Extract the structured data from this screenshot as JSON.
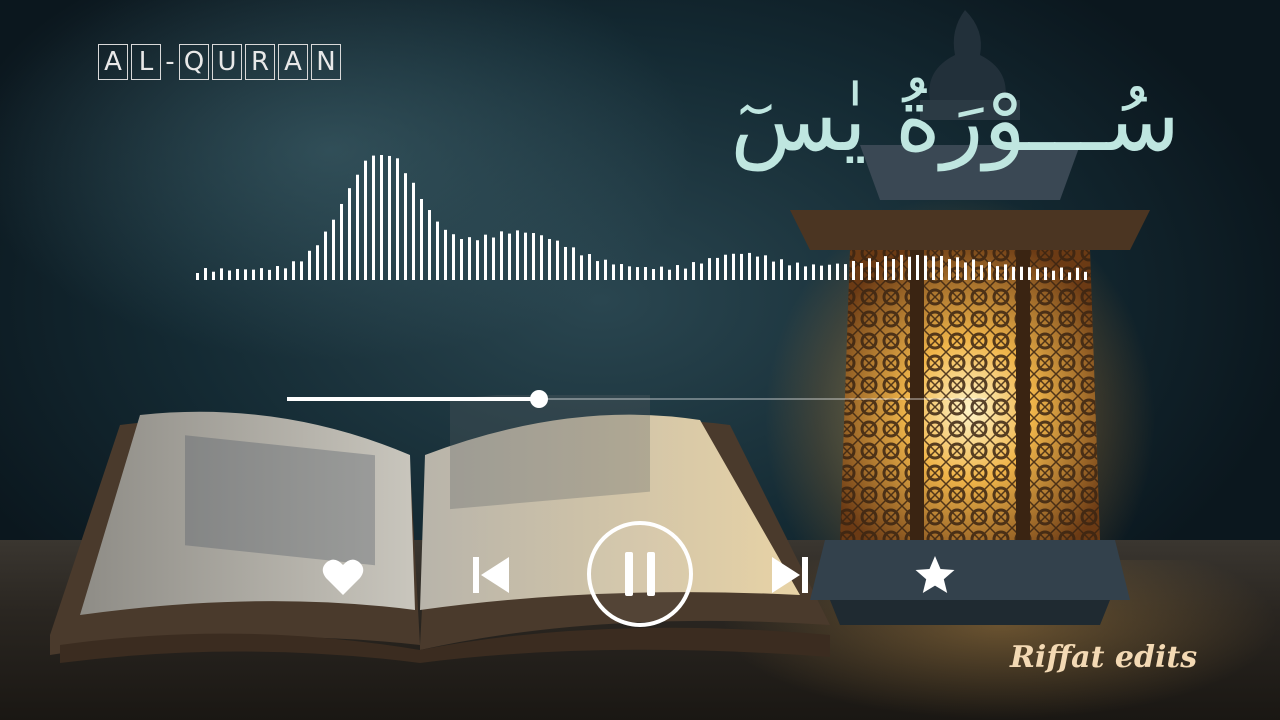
{
  "badge": {
    "letters": [
      "A",
      "L",
      "-",
      "Q",
      "U",
      "R",
      "A",
      "N"
    ]
  },
  "surah_title": "سُـــوْرَةُ يٰسٓ",
  "player": {
    "progress": 0.36,
    "controls": {
      "like_icon": "heart-icon",
      "previous_icon": "skip-previous-icon",
      "play_pause_icon": "pause-icon",
      "next_icon": "skip-next-icon",
      "favorite_icon": "star-icon"
    }
  },
  "watermark": "Riffat edits",
  "colors": {
    "title": "#bfe6e0",
    "watermark": "#f3d9b4",
    "controls": "#ffffff"
  }
}
